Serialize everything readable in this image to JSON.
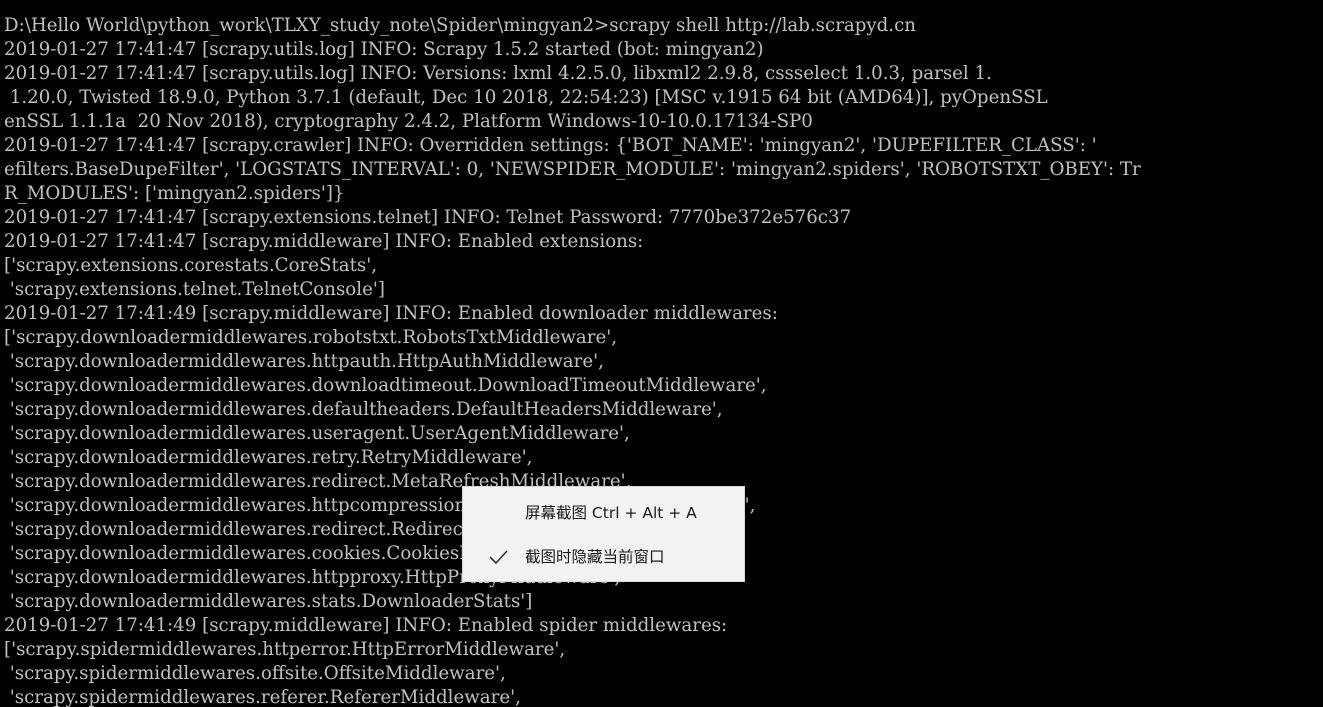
{
  "terminal": {
    "lines": [
      "D:\\Hello World\\python_work\\TLXY_study_note\\Spider\\mingyan2>scrapy shell http://lab.scrapyd.cn",
      "2019-01-27 17:41:47 [scrapy.utils.log] INFO: Scrapy 1.5.2 started (bot: mingyan2)",
      "2019-01-27 17:41:47 [scrapy.utils.log] INFO: Versions: lxml 4.2.5.0, libxml2 2.9.8, cssselect 1.0.3, parsel 1.",
      " 1.20.0, Twisted 18.9.0, Python 3.7.1 (default, Dec 10 2018, 22:54:23) [MSC v.1915 64 bit (AMD64)], pyOpenSSL",
      "enSSL 1.1.1a  20 Nov 2018), cryptography 2.4.2, Platform Windows-10-10.0.17134-SP0",
      "2019-01-27 17:41:47 [scrapy.crawler] INFO: Overridden settings: {'BOT_NAME': 'mingyan2', 'DUPEFILTER_CLASS': '",
      "efilters.BaseDupeFilter', 'LOGSTATS_INTERVAL': 0, 'NEWSPIDER_MODULE': 'mingyan2.spiders', 'ROBOTSTXT_OBEY': Tr",
      "R_MODULES': ['mingyan2.spiders']}",
      "2019-01-27 17:41:47 [scrapy.extensions.telnet] INFO: Telnet Password: 7770be372e576c37",
      "2019-01-27 17:41:47 [scrapy.middleware] INFO: Enabled extensions:",
      "['scrapy.extensions.corestats.CoreStats',",
      " 'scrapy.extensions.telnet.TelnetConsole']",
      "2019-01-27 17:41:49 [scrapy.middleware] INFO: Enabled downloader middlewares:",
      "['scrapy.downloadermiddlewares.robotstxt.RobotsTxtMiddleware',",
      " 'scrapy.downloadermiddlewares.httpauth.HttpAuthMiddleware',",
      " 'scrapy.downloadermiddlewares.downloadtimeout.DownloadTimeoutMiddleware',",
      " 'scrapy.downloadermiddlewares.defaultheaders.DefaultHeadersMiddleware',",
      " 'scrapy.downloadermiddlewares.useragent.UserAgentMiddleware',",
      " 'scrapy.downloadermiddlewares.retry.RetryMiddleware',",
      " 'scrapy.downloadermiddlewares.redirect.MetaRefreshMiddleware',",
      " 'scrapy.downloadermiddlewares.httpcompression.HttpCompressionMiddleware',",
      " 'scrapy.downloadermiddlewares.redirect.RedirectMiddleware',",
      " 'scrapy.downloadermiddlewares.cookies.CookiesMiddleware',",
      " 'scrapy.downloadermiddlewares.httpproxy.HttpProxyMiddleware',",
      " 'scrapy.downloadermiddlewares.stats.DownloaderStats']",
      "2019-01-27 17:41:49 [scrapy.middleware] INFO: Enabled spider middlewares:",
      "['scrapy.spidermiddlewares.httperror.HttpErrorMiddleware',",
      " 'scrapy.spidermiddlewares.offsite.OffsiteMiddleware',",
      " 'scrapy.spidermiddlewares.referer.RefererMiddleware',"
    ]
  },
  "overlay_menu": {
    "screenshot_label": "屏幕截图 Ctrl + Alt + A",
    "hide_window_label": "截图时隐藏当前窗口",
    "hide_window_checked": true
  },
  "colors": {
    "terminal_background": "#000000",
    "terminal_text": "#c0c0c0",
    "menu_background": "#f2f2f2",
    "menu_text": "#1a1a1a"
  },
  "icons": {
    "hide_window_check": "check-icon"
  }
}
